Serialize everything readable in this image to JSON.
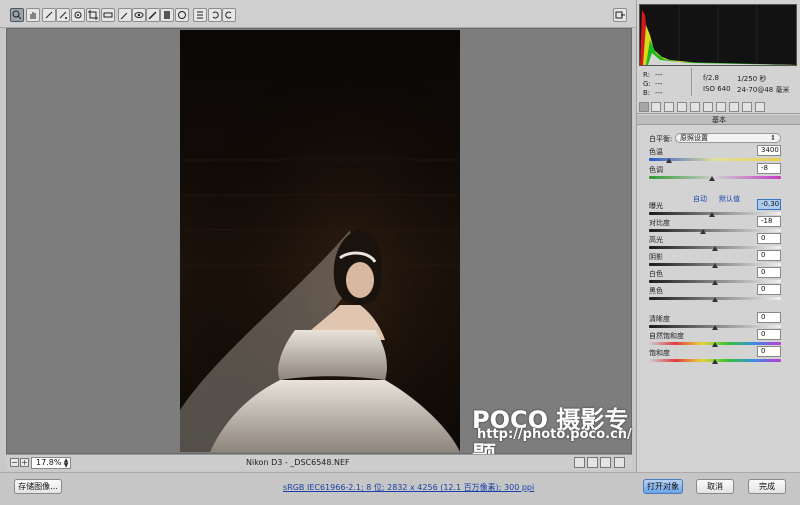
{
  "toolbar": {
    "tools": [
      "zoom-icon",
      "hand-icon",
      "white-balance-icon",
      "color-sampler-icon",
      "target-adjust-icon",
      "crop-icon",
      "straighten-icon",
      "spot-removal-icon",
      "red-eye-icon",
      "adjustment-brush-icon",
      "graduated-filter-icon",
      "radial-filter-icon",
      "preferences-icon",
      "rotate-ccw-icon",
      "rotate-cw-icon"
    ],
    "fullscreen_icon": "fullscreen-icon"
  },
  "watermark": {
    "brand": "POCO 摄影专题",
    "url": "http://photo.poco.cn/"
  },
  "status": {
    "zoom": "17.8%",
    "camera_file": "Nikon D3 -  _DSC6548.NEF"
  },
  "bottom": {
    "save_label": "存储图像...",
    "workflow_link": "sRGB IEC61966-2.1; 8 位; 2832 x 4256 (12.1 百万像素); 300 ppi",
    "open_label": "打开对象",
    "cancel_label": "取消",
    "done_label": "完成"
  },
  "exif": {
    "r_label": "R:",
    "r_value": "---",
    "g_label": "G:",
    "g_value": "---",
    "b_label": "B:",
    "b_value": "---",
    "aperture": "f/2.8",
    "shutter": "1/250 秒",
    "iso": "ISO 640",
    "lens": "24-70@48 毫米"
  },
  "panel": {
    "section_title": "基本",
    "wb_label": "白平衡:",
    "wb_value": "原照设置",
    "auto_label": "自动",
    "default_label": "默认值",
    "sliders": [
      {
        "label": "色温",
        "value": "3400",
        "pos": 0.15,
        "track": "temp"
      },
      {
        "label": "色调",
        "value": "-8",
        "pos": 0.48,
        "track": "tint"
      },
      {
        "label": "曝光",
        "value": "-0.30",
        "pos": 0.48,
        "track": "gray",
        "highlight": true
      },
      {
        "label": "对比度",
        "value": "-18",
        "pos": 0.41,
        "track": "gray"
      },
      {
        "label": "高光",
        "value": "0",
        "pos": 0.5,
        "track": "gray"
      },
      {
        "label": "阴影",
        "value": "0",
        "pos": 0.5,
        "track": "gray"
      },
      {
        "label": "白色",
        "value": "0",
        "pos": 0.5,
        "track": "gray"
      },
      {
        "label": "黑色",
        "value": "0",
        "pos": 0.5,
        "track": "gray"
      },
      {
        "label": "清晰度",
        "value": "0",
        "pos": 0.5,
        "track": "gray"
      },
      {
        "label": "自然饱和度",
        "value": "0",
        "pos": 0.5,
        "track": "sat"
      },
      {
        "label": "饱和度",
        "value": "0",
        "pos": 0.5,
        "track": "sat"
      }
    ]
  }
}
